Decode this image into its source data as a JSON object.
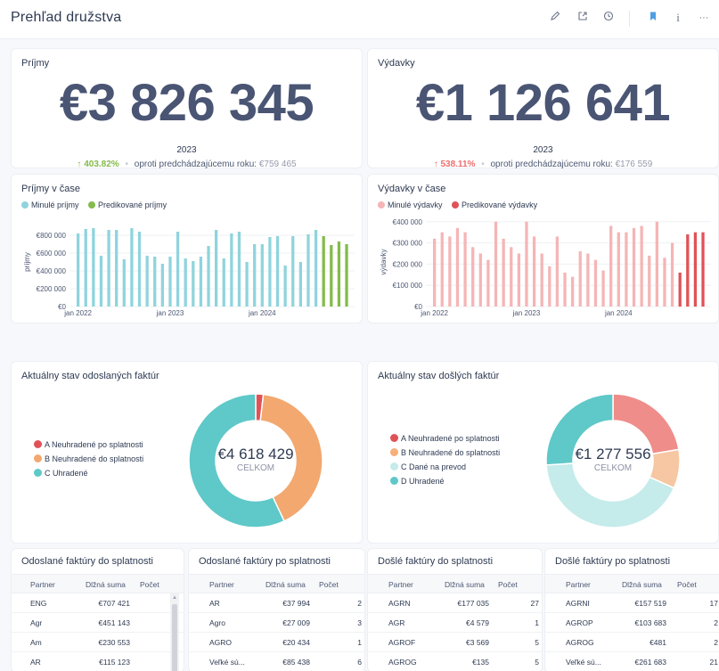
{
  "header": {
    "title": "Prehľad družstva",
    "icons": [
      "pencil-icon",
      "share-icon",
      "clock-icon",
      "bookmark-icon",
      "info-icon",
      "more-icon"
    ],
    "info_label": "i",
    "more_label": "···"
  },
  "income": {
    "title": "Príjmy",
    "value": "€3 826 345",
    "year": "2023",
    "change": "403.82%",
    "compare_label": "oproti predchádzajúcemu roku:",
    "prev_value": "€759 465"
  },
  "expenses": {
    "title": "Výdavky",
    "value": "€1 126 641",
    "year": "2023",
    "change": "538.11%",
    "compare_label": "oproti predchádzajúcemu roku:",
    "prev_value": "€176 559"
  },
  "colors": {
    "income_past": "#8fd4dd",
    "income_pred": "#84bb4c",
    "expense_past": "#f5b5b6",
    "expense_pred": "#e05257",
    "donut_red": "#e05257",
    "donut_orange": "#f2a86f",
    "donut_teal": "#5fc8c8",
    "donut_lightteal": "#c5ebeb",
    "donut_salmon": "#ef8d8b",
    "donut_peach": "#f6c7a2"
  },
  "chart_data": [
    {
      "type": "bar",
      "title": "Príjmy v čase",
      "ylabel": "príjmy",
      "xlabel": "",
      "x_ticks": [
        "jan 2022",
        "jan 2023",
        "jan 2024"
      ],
      "y_ticks": [
        "€0",
        "€200 000",
        "€400 000",
        "€600 000",
        "€800 000"
      ],
      "ylim": [
        0,
        1000000
      ],
      "series": [
        {
          "name": "Minulé príjmy",
          "values": [
            820000,
            870000,
            880000,
            570000,
            860000,
            860000,
            530000,
            880000,
            840000,
            570000,
            560000,
            480000,
            560000,
            840000,
            540000,
            510000,
            560000,
            680000,
            860000,
            540000,
            820000,
            840000,
            500000,
            700000,
            700000,
            780000,
            790000,
            460000,
            790000,
            500000,
            810000,
            860000
          ]
        },
        {
          "name": "Predikované príjmy",
          "values": [
            0,
            0,
            0,
            0,
            0,
            0,
            0,
            0,
            0,
            0,
            0,
            0,
            0,
            0,
            0,
            0,
            0,
            0,
            0,
            0,
            0,
            0,
            0,
            0,
            0,
            0,
            0,
            0,
            0,
            0,
            0,
            0,
            790000,
            690000,
            730000,
            700000
          ]
        }
      ]
    },
    {
      "type": "bar",
      "title": "Výdavky v čase",
      "ylabel": "výdavky",
      "xlabel": "",
      "x_ticks": [
        "jan 2022",
        "jan 2023",
        "jan 2024"
      ],
      "y_ticks": [
        "€0",
        "€100 000",
        "€200 000",
        "€300 000",
        "€400 000"
      ],
      "ylim": [
        0,
        420000
      ],
      "series": [
        {
          "name": "Minulé výdavky",
          "values": [
            320000,
            350000,
            330000,
            370000,
            350000,
            280000,
            250000,
            220000,
            400000,
            320000,
            280000,
            250000,
            400000,
            330000,
            250000,
            190000,
            330000,
            160000,
            140000,
            260000,
            250000,
            220000,
            170000,
            380000,
            350000,
            350000,
            370000,
            380000,
            240000,
            400000,
            230000,
            300000
          ]
        },
        {
          "name": "Predikované výdavky",
          "values": [
            0,
            0,
            0,
            0,
            0,
            0,
            0,
            0,
            0,
            0,
            0,
            0,
            0,
            0,
            0,
            0,
            0,
            0,
            0,
            0,
            0,
            0,
            0,
            0,
            0,
            0,
            0,
            0,
            0,
            0,
            0,
            0,
            160000,
            340000,
            350000,
            350000
          ]
        }
      ]
    },
    {
      "type": "pie",
      "title": "Aktuálny stav odoslaných faktúr",
      "center_value": "€4 618 429",
      "center_label": "CELKOM",
      "labels": [
        "A Neuhradené po splatnosti",
        "B Neuhradené do splatnosti",
        "C Uhradené"
      ],
      "values": [
        85000,
        1900000,
        2633429
      ]
    },
    {
      "type": "pie",
      "title": "Aktuálny stav došlých faktúr",
      "center_value": "€1 277 556",
      "center_label": "CELKOM",
      "labels": [
        "A Neuhradené po splatnosti",
        "B Neuhradené do splatnosti",
        "C Dané na prevod",
        "D Uhradené"
      ],
      "values": [
        285000,
        120000,
        540000,
        332556
      ]
    }
  ],
  "tables": [
    {
      "title": "Odoslané faktúry do splatnosti",
      "headers": [
        "Partner",
        "Dlžná suma",
        "Počet"
      ],
      "rows": [
        [
          "ENG",
          "€707 421",
          ""
        ],
        [
          "Agr",
          "€451 143",
          ""
        ],
        [
          "Am",
          "€230 553",
          ""
        ],
        [
          "AR",
          "€115 123",
          ""
        ]
      ]
    },
    {
      "title": "Odoslané faktúry po splatnosti",
      "headers": [
        "Partner",
        "Dlžná suma",
        "Počet"
      ],
      "rows": [
        [
          "AR",
          "€37 994",
          "2"
        ],
        [
          "Agro",
          "€27 009",
          "3"
        ],
        [
          "AGRO",
          "€20 434",
          "1"
        ],
        [
          "Veľké sú...",
          "€85 438",
          "6"
        ]
      ]
    },
    {
      "title": "Došlé faktúry do splatnosti",
      "headers": [
        "Partner",
        "Dlžná suma",
        "Počet"
      ],
      "rows": [
        [
          "AGRN",
          "€177 035",
          "27"
        ],
        [
          "AGR",
          "€4 579",
          "1"
        ],
        [
          "AGROF",
          "€3 569",
          "5"
        ],
        [
          "AGROG",
          "€135",
          "5"
        ]
      ]
    },
    {
      "title": "Došlé faktúry po splatnosti",
      "headers": [
        "Partner",
        "Dlžná suma",
        "Počet"
      ],
      "rows": [
        [
          "AGRNI",
          "€157 519",
          "17"
        ],
        [
          "AGROP",
          "€103 683",
          "2"
        ],
        [
          "AGROG",
          "€481",
          "2"
        ],
        [
          "Veľké sú...",
          "€261 683",
          "21"
        ]
      ]
    }
  ]
}
